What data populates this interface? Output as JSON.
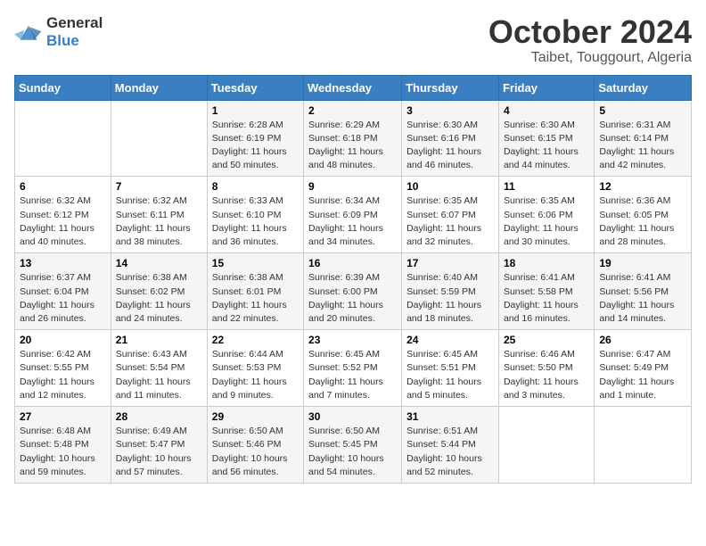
{
  "logo": {
    "line1": "General",
    "line2": "Blue"
  },
  "title": "October 2024",
  "location": "Taibet, Touggourt, Algeria",
  "days_header": [
    "Sunday",
    "Monday",
    "Tuesday",
    "Wednesday",
    "Thursday",
    "Friday",
    "Saturday"
  ],
  "weeks": [
    [
      {
        "day": "",
        "info": ""
      },
      {
        "day": "",
        "info": ""
      },
      {
        "day": "1",
        "info": "Sunrise: 6:28 AM\nSunset: 6:19 PM\nDaylight: 11 hours and 50 minutes."
      },
      {
        "day": "2",
        "info": "Sunrise: 6:29 AM\nSunset: 6:18 PM\nDaylight: 11 hours and 48 minutes."
      },
      {
        "day": "3",
        "info": "Sunrise: 6:30 AM\nSunset: 6:16 PM\nDaylight: 11 hours and 46 minutes."
      },
      {
        "day": "4",
        "info": "Sunrise: 6:30 AM\nSunset: 6:15 PM\nDaylight: 11 hours and 44 minutes."
      },
      {
        "day": "5",
        "info": "Sunrise: 6:31 AM\nSunset: 6:14 PM\nDaylight: 11 hours and 42 minutes."
      }
    ],
    [
      {
        "day": "6",
        "info": "Sunrise: 6:32 AM\nSunset: 6:12 PM\nDaylight: 11 hours and 40 minutes."
      },
      {
        "day": "7",
        "info": "Sunrise: 6:32 AM\nSunset: 6:11 PM\nDaylight: 11 hours and 38 minutes."
      },
      {
        "day": "8",
        "info": "Sunrise: 6:33 AM\nSunset: 6:10 PM\nDaylight: 11 hours and 36 minutes."
      },
      {
        "day": "9",
        "info": "Sunrise: 6:34 AM\nSunset: 6:09 PM\nDaylight: 11 hours and 34 minutes."
      },
      {
        "day": "10",
        "info": "Sunrise: 6:35 AM\nSunset: 6:07 PM\nDaylight: 11 hours and 32 minutes."
      },
      {
        "day": "11",
        "info": "Sunrise: 6:35 AM\nSunset: 6:06 PM\nDaylight: 11 hours and 30 minutes."
      },
      {
        "day": "12",
        "info": "Sunrise: 6:36 AM\nSunset: 6:05 PM\nDaylight: 11 hours and 28 minutes."
      }
    ],
    [
      {
        "day": "13",
        "info": "Sunrise: 6:37 AM\nSunset: 6:04 PM\nDaylight: 11 hours and 26 minutes."
      },
      {
        "day": "14",
        "info": "Sunrise: 6:38 AM\nSunset: 6:02 PM\nDaylight: 11 hours and 24 minutes."
      },
      {
        "day": "15",
        "info": "Sunrise: 6:38 AM\nSunset: 6:01 PM\nDaylight: 11 hours and 22 minutes."
      },
      {
        "day": "16",
        "info": "Sunrise: 6:39 AM\nSunset: 6:00 PM\nDaylight: 11 hours and 20 minutes."
      },
      {
        "day": "17",
        "info": "Sunrise: 6:40 AM\nSunset: 5:59 PM\nDaylight: 11 hours and 18 minutes."
      },
      {
        "day": "18",
        "info": "Sunrise: 6:41 AM\nSunset: 5:58 PM\nDaylight: 11 hours and 16 minutes."
      },
      {
        "day": "19",
        "info": "Sunrise: 6:41 AM\nSunset: 5:56 PM\nDaylight: 11 hours and 14 minutes."
      }
    ],
    [
      {
        "day": "20",
        "info": "Sunrise: 6:42 AM\nSunset: 5:55 PM\nDaylight: 11 hours and 12 minutes."
      },
      {
        "day": "21",
        "info": "Sunrise: 6:43 AM\nSunset: 5:54 PM\nDaylight: 11 hours and 11 minutes."
      },
      {
        "day": "22",
        "info": "Sunrise: 6:44 AM\nSunset: 5:53 PM\nDaylight: 11 hours and 9 minutes."
      },
      {
        "day": "23",
        "info": "Sunrise: 6:45 AM\nSunset: 5:52 PM\nDaylight: 11 hours and 7 minutes."
      },
      {
        "day": "24",
        "info": "Sunrise: 6:45 AM\nSunset: 5:51 PM\nDaylight: 11 hours and 5 minutes."
      },
      {
        "day": "25",
        "info": "Sunrise: 6:46 AM\nSunset: 5:50 PM\nDaylight: 11 hours and 3 minutes."
      },
      {
        "day": "26",
        "info": "Sunrise: 6:47 AM\nSunset: 5:49 PM\nDaylight: 11 hours and 1 minute."
      }
    ],
    [
      {
        "day": "27",
        "info": "Sunrise: 6:48 AM\nSunset: 5:48 PM\nDaylight: 10 hours and 59 minutes."
      },
      {
        "day": "28",
        "info": "Sunrise: 6:49 AM\nSunset: 5:47 PM\nDaylight: 10 hours and 57 minutes."
      },
      {
        "day": "29",
        "info": "Sunrise: 6:50 AM\nSunset: 5:46 PM\nDaylight: 10 hours and 56 minutes."
      },
      {
        "day": "30",
        "info": "Sunrise: 6:50 AM\nSunset: 5:45 PM\nDaylight: 10 hours and 54 minutes."
      },
      {
        "day": "31",
        "info": "Sunrise: 6:51 AM\nSunset: 5:44 PM\nDaylight: 10 hours and 52 minutes."
      },
      {
        "day": "",
        "info": ""
      },
      {
        "day": "",
        "info": ""
      }
    ]
  ]
}
